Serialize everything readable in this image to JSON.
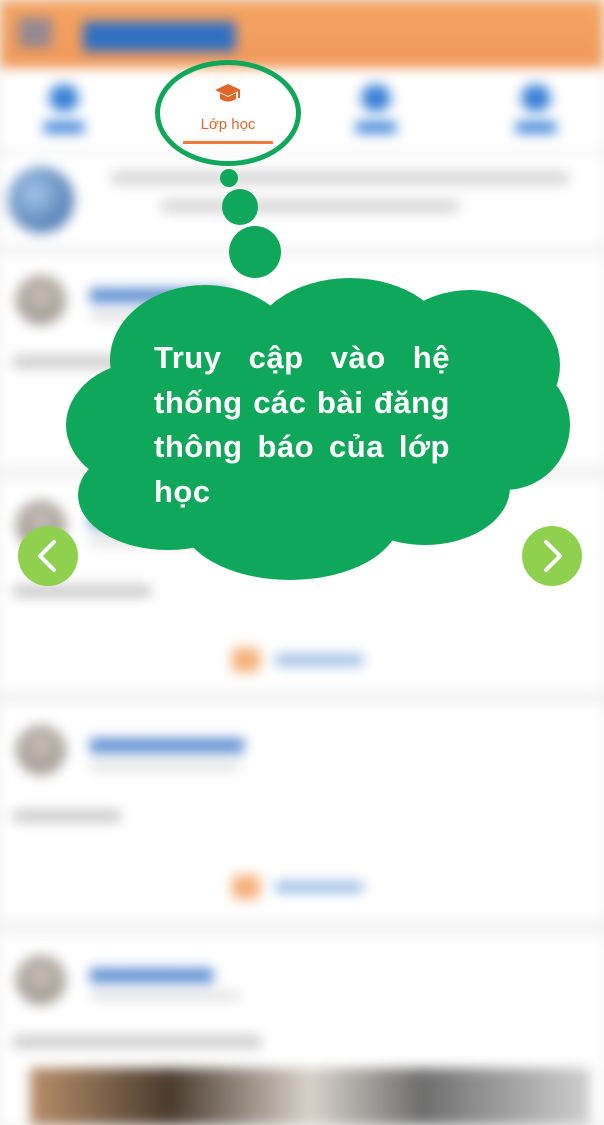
{
  "background_app": {
    "active_tab_label": "Lớp học"
  },
  "tooltip": {
    "text": "Truy cập vào hệ thống các bài đăng thông báo của lớp học"
  },
  "navigation": {
    "prev_icon": "chevron-left-icon",
    "next_icon": "chevron-right-icon"
  },
  "colors": {
    "bubble": "#0fa85a",
    "arrow": "#8fd14f",
    "header": "#f0995a",
    "active_tab": "#e2662a"
  }
}
